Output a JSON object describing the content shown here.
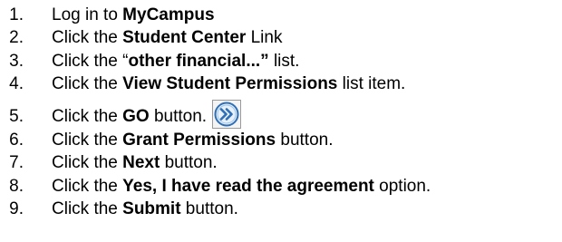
{
  "steps": [
    {
      "num": "1.",
      "pre": "Log in to ",
      "bold": "MyCampus",
      "post": ""
    },
    {
      "num": "2.",
      "pre": "Click the ",
      "bold": "Student Center",
      "post": " Link"
    },
    {
      "num": "3.",
      "pre": "Click the “",
      "bold": "other financial...”",
      "post": " list."
    },
    {
      "num": "4.",
      "pre": "Click the ",
      "bold": "View Student Permissions",
      "post": " list item."
    },
    {
      "num": "5.",
      "pre": "Click the ",
      "bold": "GO",
      "post": " button."
    },
    {
      "num": "6.",
      "pre": "Click the ",
      "bold": "Grant Permissions",
      "post": " button."
    },
    {
      "num": "7.",
      "pre": "Click the ",
      "bold": "Next",
      "post": " button."
    },
    {
      "num": "8.",
      "pre": "Click the ",
      "bold": "Yes, I have read the agreement",
      "post": " option."
    },
    {
      "num": "9.",
      "pre": "Click the ",
      "bold": "Submit",
      "post": " button."
    }
  ],
  "go_icon": "go-double-chevron-icon",
  "colors": {
    "text": "#000000",
    "go_icon_ring": "#2f6fb6",
    "go_icon_fill": "#e8f1fb"
  }
}
